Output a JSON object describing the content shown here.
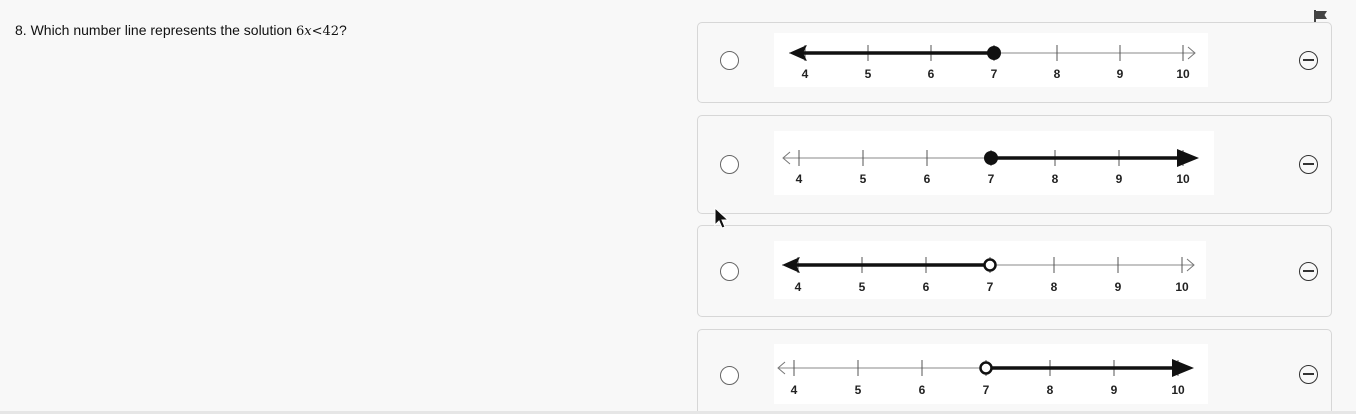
{
  "question": {
    "prefix": "8. Which number line represents the solution ",
    "math_coef": "6",
    "math_var": "x",
    "math_op": "<",
    "math_rhs": "42",
    "suffix": "?"
  },
  "flag_icon": "flag-icon",
  "tick_labels": [
    "4",
    "5",
    "6",
    "7",
    "8",
    "9",
    "10"
  ],
  "options": [
    {
      "shading": "left",
      "point": "closed",
      "boundary": 7
    },
    {
      "shading": "right",
      "point": "closed",
      "boundary": 7
    },
    {
      "shading": "left",
      "point": "open",
      "boundary": 7
    },
    {
      "shading": "right",
      "point": "open",
      "boundary": 7
    }
  ]
}
